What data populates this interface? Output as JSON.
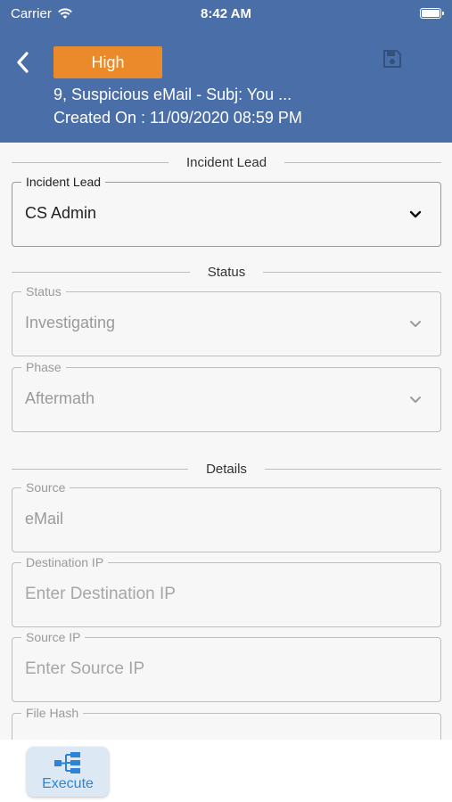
{
  "status_bar": {
    "carrier": "Carrier",
    "time": "8:42 AM"
  },
  "header": {
    "priority": "High",
    "priority_color": "#ea8a2a",
    "title": "9, Suspicious eMail - Subj: You ...",
    "created_on": "Created On : 11/09/2020 08:59 PM",
    "background_color": "#4a6ea8",
    "icons": {
      "back": "chevron-left-icon",
      "save": "save-icon"
    }
  },
  "sections": {
    "incident_lead": "Incident Lead",
    "status": "Status",
    "details": "Details"
  },
  "fields": {
    "incident_lead": {
      "label": "Incident Lead",
      "value": "CS Admin"
    },
    "status": {
      "label": "Status",
      "value": "Investigating"
    },
    "phase": {
      "label": "Phase",
      "value": "Aftermath"
    },
    "source": {
      "label": "Source",
      "value": "eMail"
    },
    "destination_ip": {
      "label": "Destination IP",
      "placeholder": "Enter Destination IP"
    },
    "source_ip": {
      "label": "Source IP",
      "placeholder": "Enter Source IP"
    },
    "file_hash": {
      "label": "File Hash"
    }
  },
  "bottom_bar": {
    "execute_label": "Execute",
    "execute_icon": "workflow-icon",
    "accent_color": "#2d83d8"
  }
}
